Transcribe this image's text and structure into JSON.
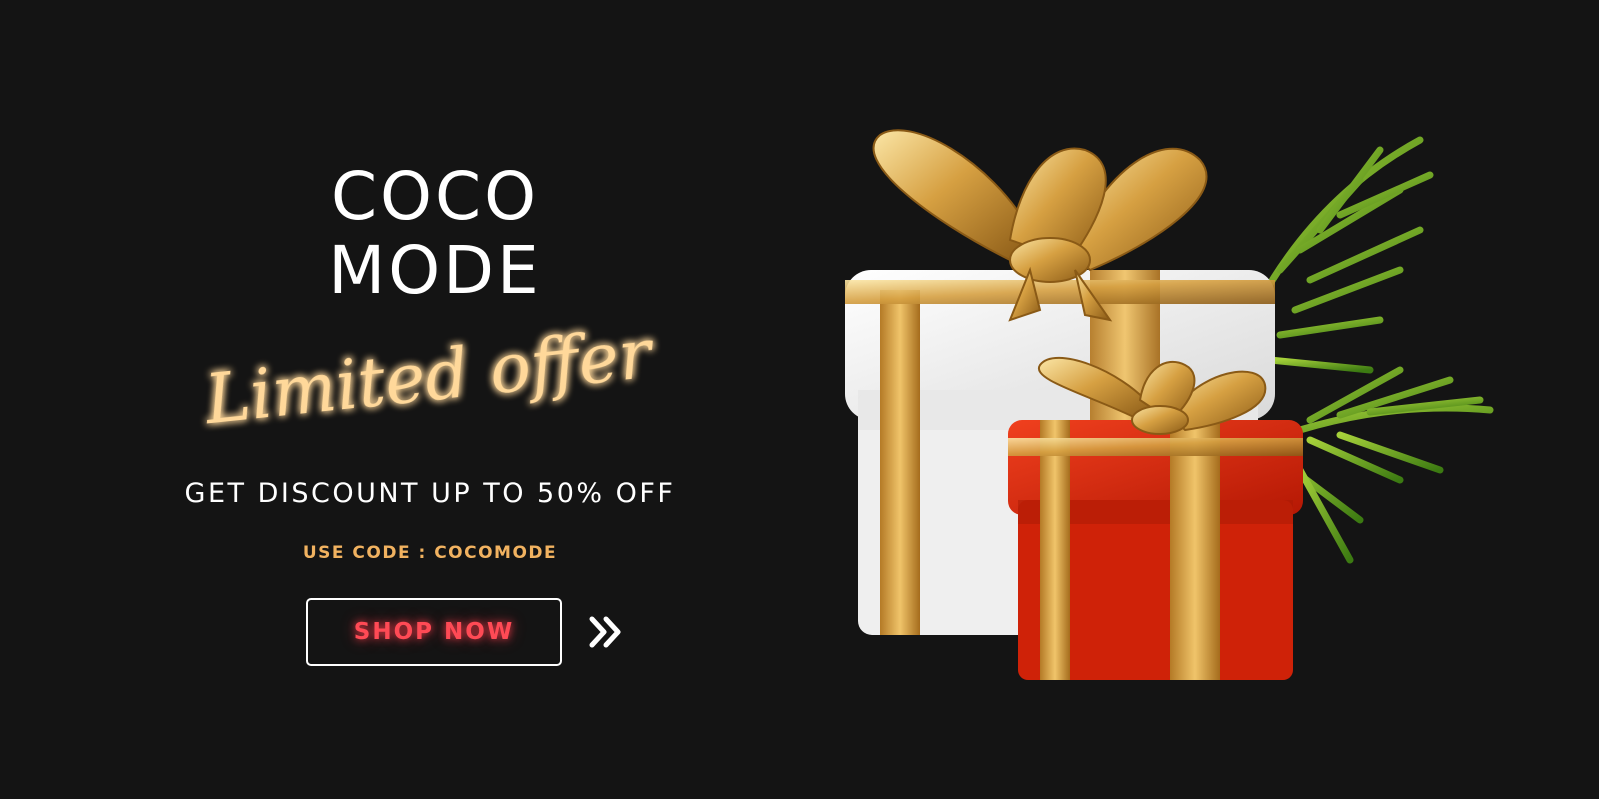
{
  "brand": {
    "line1": "COCO",
    "line2": "MODE"
  },
  "tagline": "Limited offer",
  "discount_text": "GET DISCOUNT UP TO 50% OFF",
  "code_text": "USE CODE : COCOMODE",
  "cta": {
    "label": "SHOP NOW",
    "arrow_icon": "double-chevron-right-icon"
  },
  "colors": {
    "background": "#141414",
    "gold": "#f1b260",
    "cta_text": "#ff4a55",
    "gift_red": "#d9260e",
    "gift_white": "#f4f4f4",
    "ribbon_gold": "#d6a042",
    "leaf_green": "#5a9a1a"
  },
  "illustration": "gift-boxes-illustration"
}
